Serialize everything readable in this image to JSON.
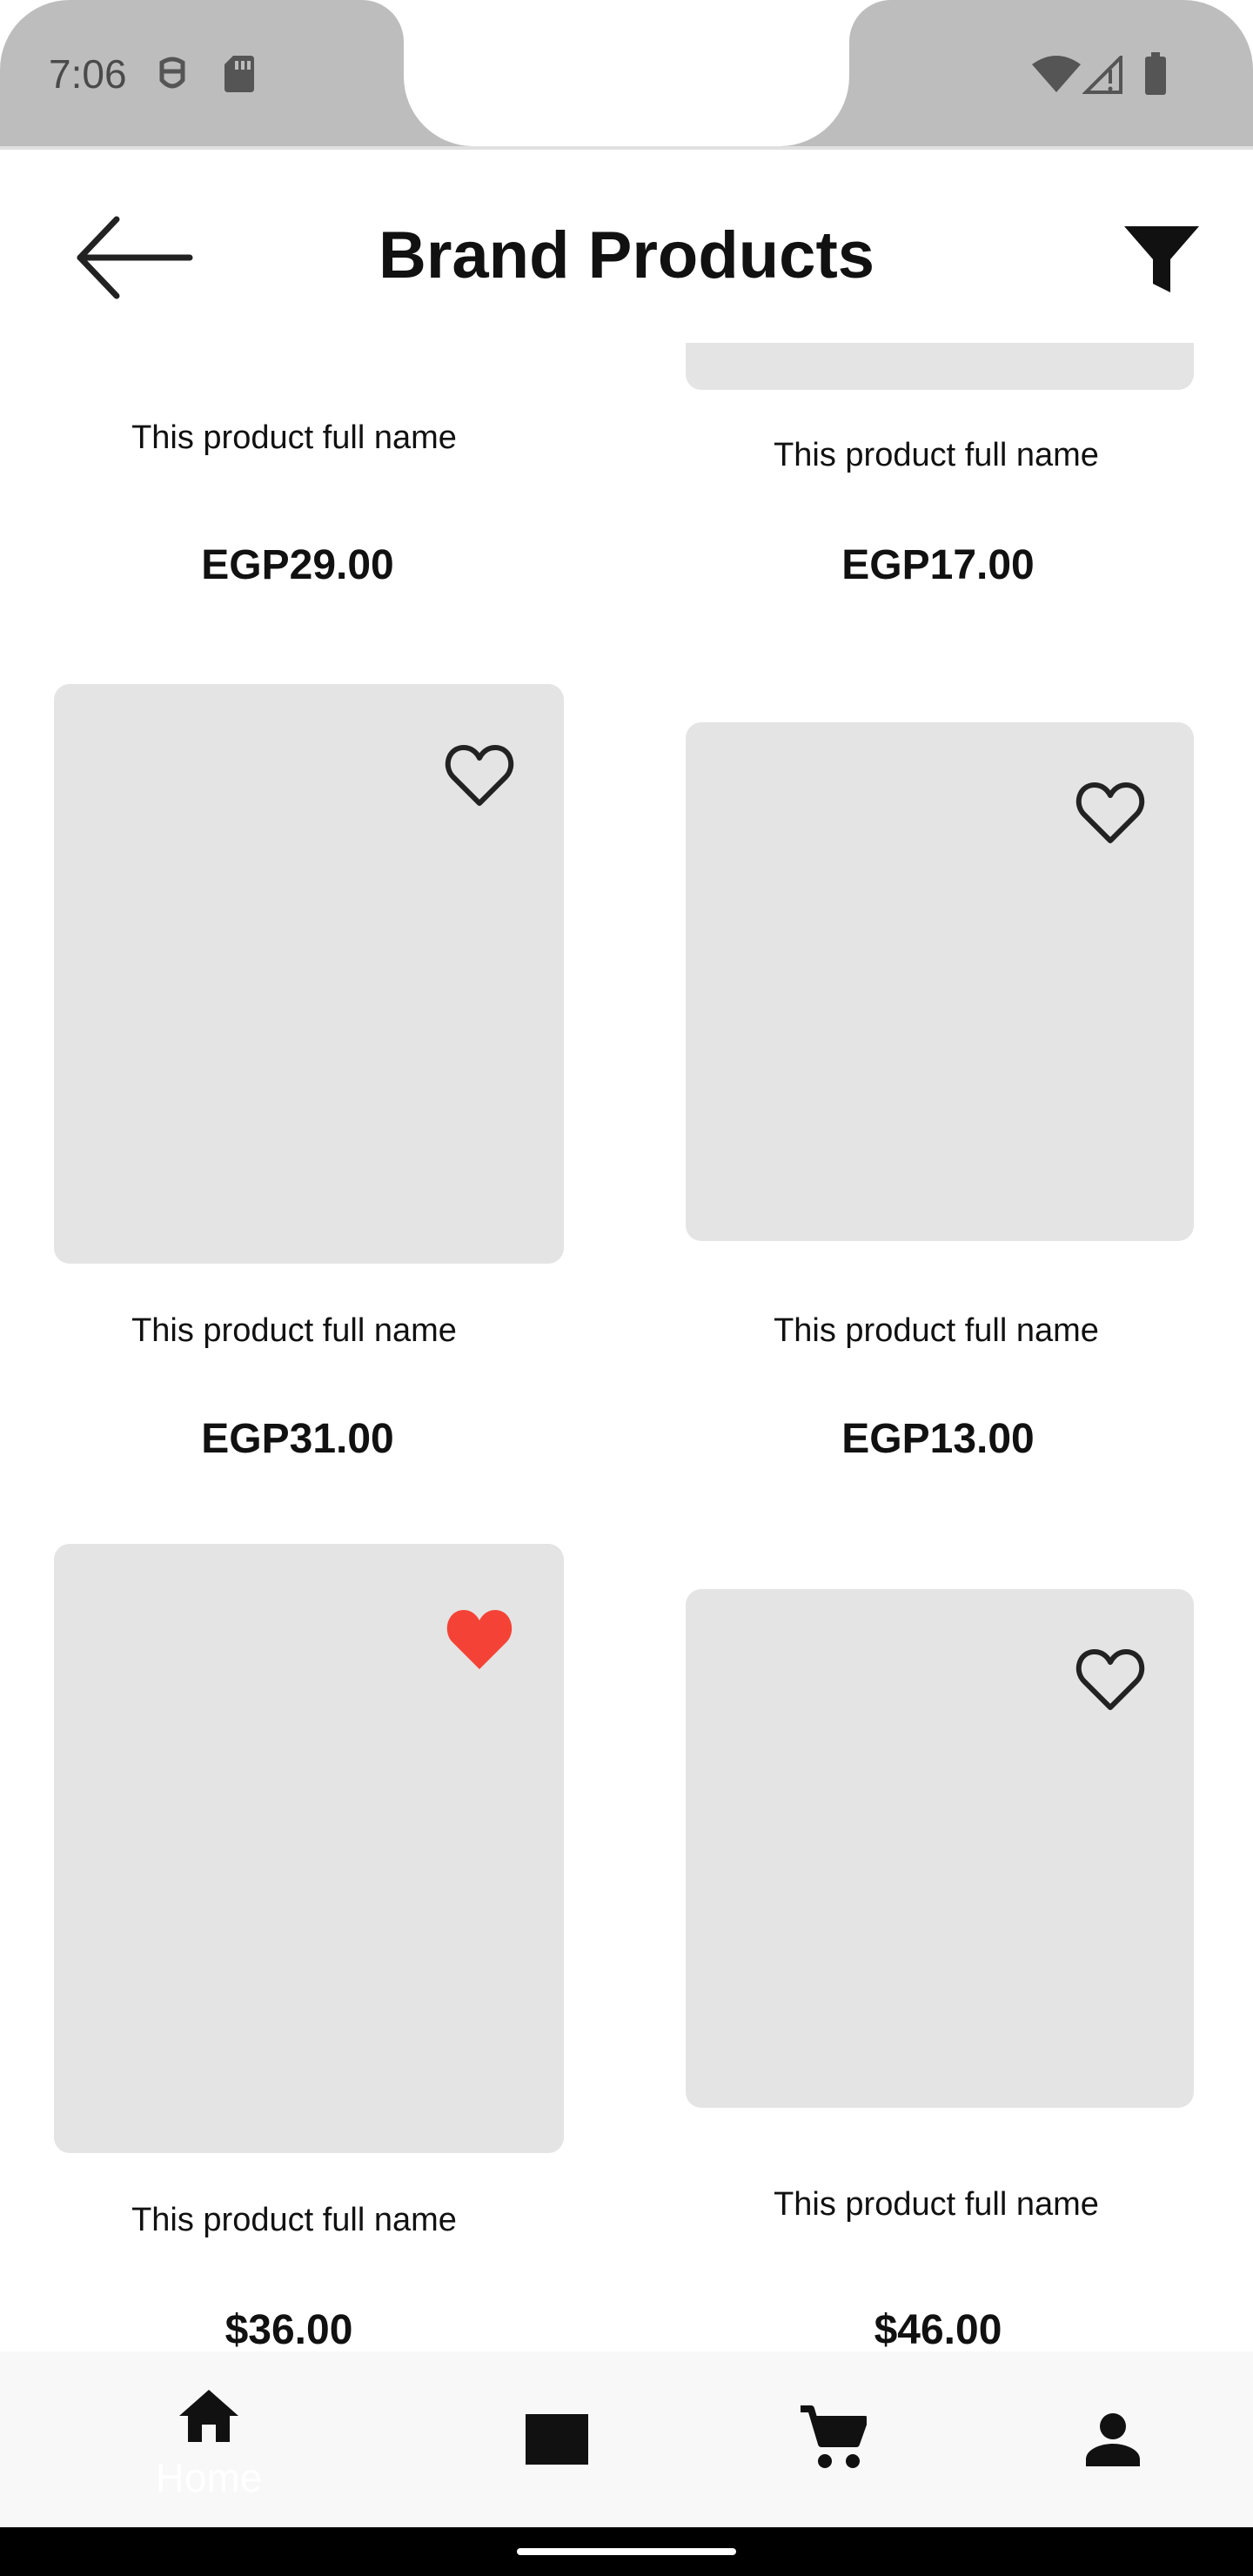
{
  "status_bar": {
    "time": "7:06",
    "icons": [
      "face-icon",
      "sd-card-icon",
      "wifi-icon",
      "signal-icon",
      "battery-icon"
    ]
  },
  "app_bar": {
    "title": "Brand Products",
    "back_icon": "arrow-left-icon",
    "filter_icon": "filter-icon"
  },
  "products": [
    {
      "name": "This product full name",
      "price": "EGP29.00",
      "favorite": false
    },
    {
      "name": "This product full name",
      "price": "EGP17.00",
      "favorite": false
    },
    {
      "name": "This product full name",
      "price": "EGP31.00",
      "favorite": false
    },
    {
      "name": "This product full name",
      "price": "EGP13.00",
      "favorite": false
    },
    {
      "name": "This product full name",
      "price": "$36.00",
      "favorite": true
    },
    {
      "name": "This product full name",
      "price": "$46.00",
      "favorite": false
    }
  ],
  "bottom_nav": {
    "items": [
      {
        "label": "Home",
        "icon": "home-icon",
        "active": true
      },
      {
        "label": "",
        "icon": "category-icon",
        "active": false
      },
      {
        "label": "",
        "icon": "cart-icon",
        "active": false
      },
      {
        "label": "",
        "icon": "person-icon",
        "active": false
      }
    ]
  },
  "colors": {
    "favorite_heart": "#f44336",
    "image_placeholder": "#e4e4e4",
    "status_bar": "#bdbdbd"
  }
}
